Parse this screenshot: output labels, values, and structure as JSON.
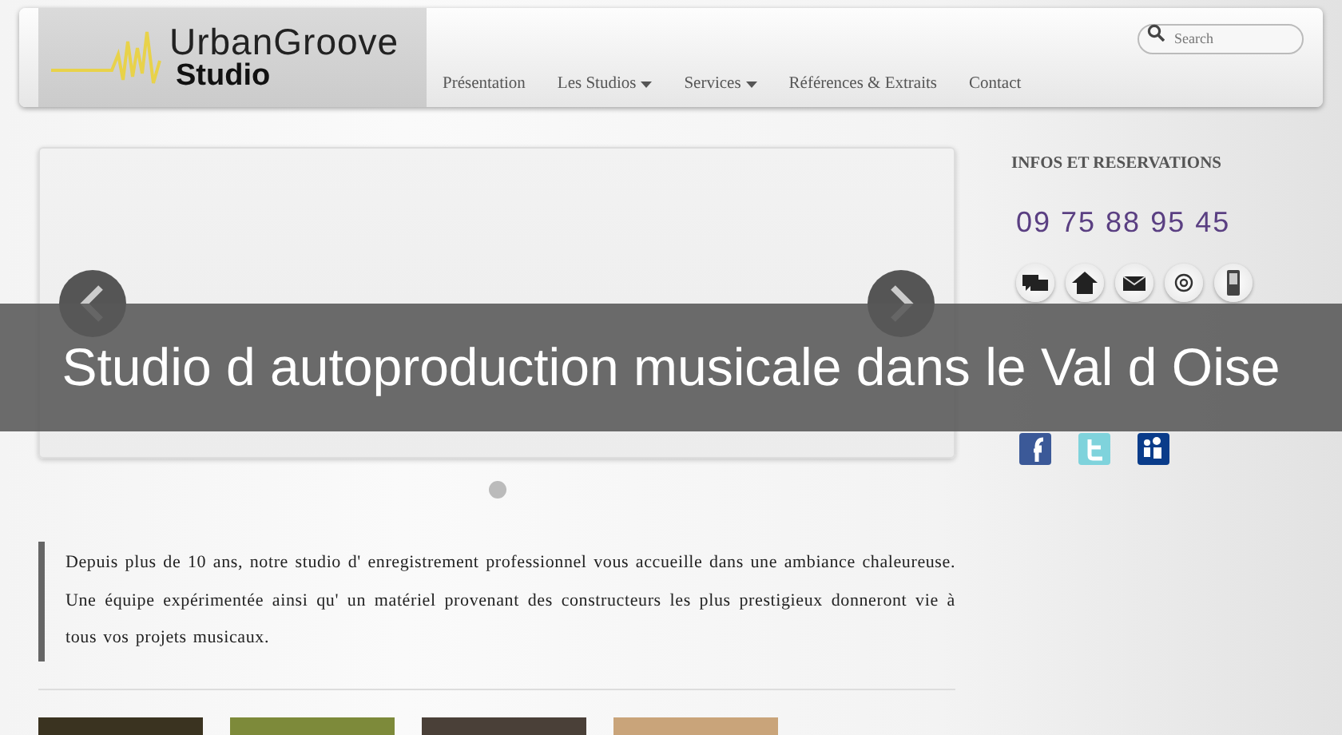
{
  "header": {
    "logo_top": "UrbanGroove",
    "logo_bottom": "Studio",
    "nav": [
      {
        "label": "Présentation",
        "has_menu": false
      },
      {
        "label": "Les Studios",
        "has_menu": true
      },
      {
        "label": "Services",
        "has_menu": true
      },
      {
        "label": "Références & Extraits",
        "has_menu": false
      },
      {
        "label": "Contact",
        "has_menu": false
      }
    ],
    "search": {
      "placeholder": "Search"
    }
  },
  "carousel": {
    "slides": [
      {
        "selected": true
      }
    ]
  },
  "intro": "Depuis plus de 10 ans, notre studio d' enregistrement professionnel vous accueille dans une ambiance chaleureuse. Une équipe expérimentée ainsi qu' un matériel provenant des constructeurs les plus prestigieux donneront vie à tous vos projets musicaux.",
  "thumbnails": [
    {
      "kind": "photo"
    },
    {
      "kind": "photo"
    },
    {
      "kind": "photo"
    },
    {
      "kind": "photo"
    }
  ],
  "sidebar": {
    "heading": "INFOS ET RESERVATIONS",
    "phone": "09 75 88 95 45"
  },
  "banner": "Studio d autoproduction musicale dans le Val d Oise"
}
